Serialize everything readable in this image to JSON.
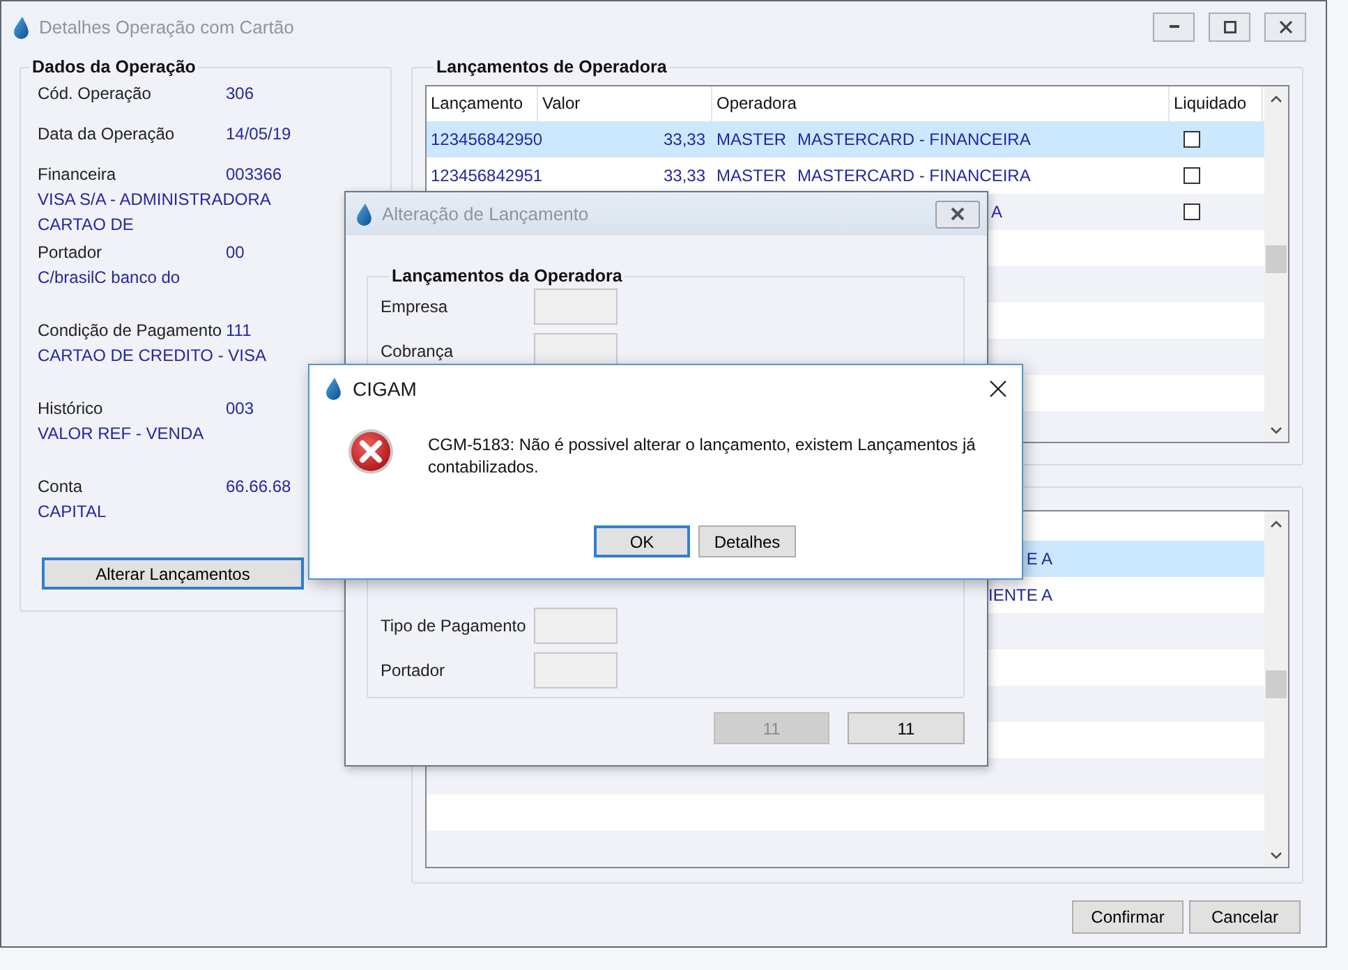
{
  "main_window": {
    "title": "Detalhes Operação com Cartão",
    "active": false
  },
  "operation_panel": {
    "title": "Dados da Operação",
    "fields": [
      {
        "label": "Cód. Operação",
        "value": "306"
      },
      {
        "label": "Data da Operação",
        "value": "14/05/19"
      },
      {
        "label": "Financeira",
        "value": "003366",
        "description": "VISA S/A - ADMINISTRADORA CARTAO DE"
      },
      {
        "label": "Portador",
        "value": "00",
        "description": "C/brasilC banco do"
      },
      {
        "label": "Condição de Pagamento",
        "value": "111",
        "description": "CARTAO DE CREDITO - VISA"
      },
      {
        "label": "Histórico",
        "value": "003",
        "description": "VALOR REF - VENDA"
      },
      {
        "label": "Conta",
        "value": "66.66.68",
        "description": "CAPITAL"
      }
    ],
    "button": {
      "label": "Alterar Lançamentos",
      "focused": true
    }
  },
  "operator_entries": {
    "title": "Lançamentos de Operadora",
    "columns": [
      "Lançamento",
      "Valor",
      "Operadora",
      "Liquidado"
    ],
    "rows": [
      {
        "kind": "full",
        "lancamento": "123456842950",
        "valor": "33,33",
        "operadora_code": "MASTER",
        "operadora_name": "MASTERCARD - FINANCEIRA",
        "liquidado": false,
        "selected": true
      },
      {
        "kind": "full",
        "lancamento": "123456842951",
        "valor": "33,33",
        "operadora_code": "MASTER",
        "operadora_name": "MASTERCARD - FINANCEIRA",
        "liquidado": false,
        "selected": false
      },
      {
        "kind": "partial",
        "operadora_name": "A",
        "liquidado": false,
        "selected": false
      }
    ]
  },
  "lower_list": {
    "rows": [
      {
        "text": "E A",
        "selected": true
      },
      {
        "text": "IENTE A",
        "selected": false
      }
    ]
  },
  "edit_dialog": {
    "title": "Alteração de Lançamento",
    "active": false,
    "group_title": "Lançamentos da Operadora",
    "fields_top": [
      "Empresa",
      "Cobrança"
    ],
    "fields_bottom": [
      "Tipo de Pagamento",
      "Portador"
    ],
    "buttons": [
      {
        "label": "11",
        "disabled": true
      },
      {
        "label": "11",
        "disabled": false
      }
    ]
  },
  "message_dialog": {
    "title": "CIGAM",
    "active": true,
    "message": "CGM-5183: Não é possivel alterar o lançamento, existem Lançamentos já contabilizados.",
    "buttons": [
      {
        "label": "OK",
        "focused": true
      },
      {
        "label": "Detalhes",
        "focused": false
      }
    ]
  },
  "footer_buttons": [
    "Confirmar",
    "Cancelar"
  ]
}
